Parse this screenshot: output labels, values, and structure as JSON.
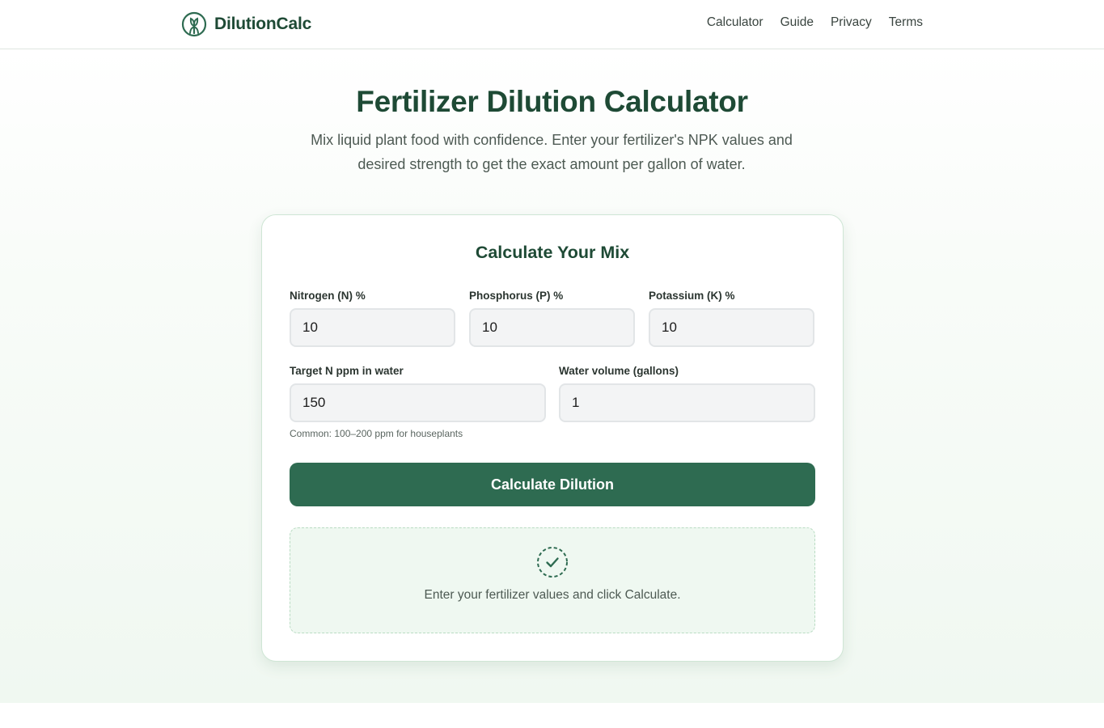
{
  "brand": {
    "name": "DilutionCalc",
    "logo_icon": "sprout-circle-icon",
    "color": "#1e4a35"
  },
  "nav": {
    "links": [
      "Calculator",
      "Guide",
      "Privacy",
      "Terms"
    ]
  },
  "hero": {
    "title": "Fertilizer Dilution Calculator",
    "subtitle": "Mix liquid plant food with confidence. Enter your fertilizer's NPK values and desired strength to get the exact amount per gallon of water."
  },
  "calculator": {
    "title": "Calculate Your Mix",
    "fields": {
      "nitrogen": {
        "label": "Nitrogen (N) %",
        "value": "10"
      },
      "phosphorus": {
        "label": "Phosphorus (P) %",
        "value": "10"
      },
      "potassium": {
        "label": "Potassium (K) %",
        "value": "10"
      },
      "target_ppm": {
        "label": "Target N ppm in water",
        "value": "150",
        "hint": "Common: 100–200 ppm for houseplants"
      },
      "water_volume": {
        "label": "Water volume (gallons)",
        "value": "1"
      }
    },
    "button_label": "Calculate Dilution",
    "result": {
      "icon": "dashed-circle-check-icon",
      "message": "Enter your fertilizer values and click Calculate."
    }
  },
  "colors": {
    "accent": "#2e6b51",
    "heading": "#1e4a35",
    "result_bg": "#eff8f1"
  }
}
